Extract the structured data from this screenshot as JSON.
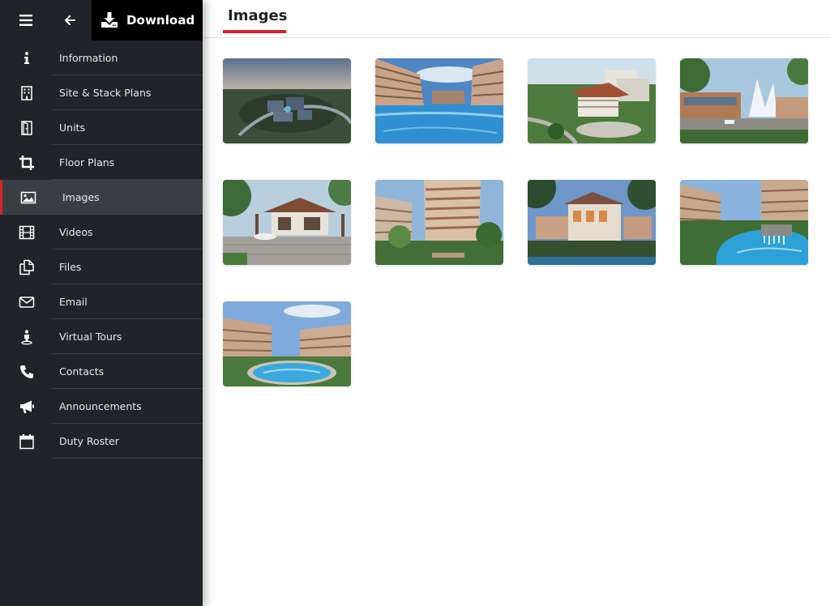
{
  "toolbar": {
    "download_label": "Download"
  },
  "sidebar": {
    "active_color": "#d9232d",
    "items": [
      {
        "label": "Information",
        "icon": "info-icon"
      },
      {
        "label": "Site & Stack Plans",
        "icon": "building-icon"
      },
      {
        "label": "Units",
        "icon": "door-icon"
      },
      {
        "label": "Floor Plans",
        "icon": "crop-icon"
      },
      {
        "label": "Images",
        "icon": "image-icon",
        "active": true
      },
      {
        "label": "Videos",
        "icon": "film-icon"
      },
      {
        "label": "Files",
        "icon": "files-icon"
      },
      {
        "label": "Email",
        "icon": "envelope-icon"
      },
      {
        "label": "Virtual Tours",
        "icon": "street-view-icon"
      },
      {
        "label": "Contacts",
        "icon": "phone-icon"
      },
      {
        "label": "Announcements",
        "icon": "megaphone-icon"
      },
      {
        "label": "Duty Roster",
        "icon": "calendar-icon"
      }
    ]
  },
  "main": {
    "title": "Images",
    "images": [
      {
        "subject": "aerial view of condominium"
      },
      {
        "subject": "pool with apartment blocks"
      },
      {
        "subject": "clubhouse and blocks on hill"
      },
      {
        "subject": "entrance with sculpture"
      },
      {
        "subject": "drop-off porch with car"
      },
      {
        "subject": "apartment blocks with garden"
      },
      {
        "subject": "clubhouse at dusk"
      },
      {
        "subject": "lagoon pool with waterfall"
      },
      {
        "subject": "round pool with blocks"
      }
    ]
  }
}
